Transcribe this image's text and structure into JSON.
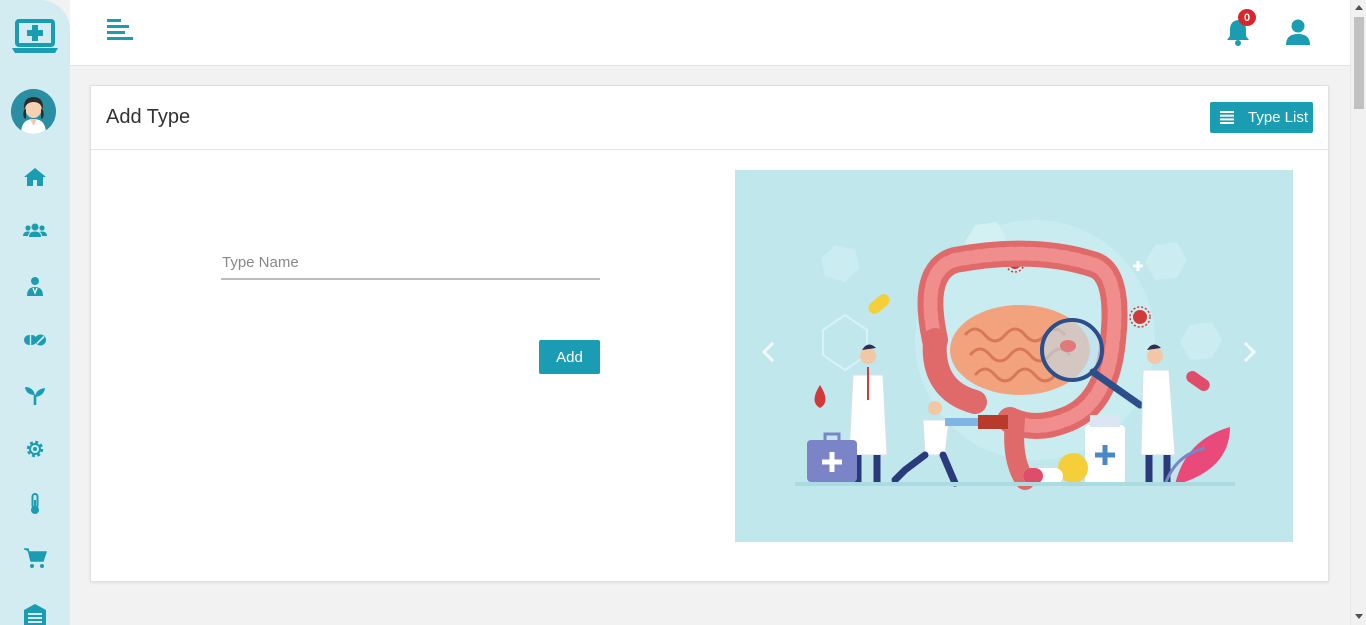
{
  "app": {
    "brand_icon": "medical-laptop-icon",
    "accent_color": "#1a9db3"
  },
  "sidebar": {
    "avatar": "doctor-avatar",
    "items": [
      {
        "icon": "home-icon"
      },
      {
        "icon": "users-icon"
      },
      {
        "icon": "doctor-icon"
      },
      {
        "icon": "pills-icon"
      },
      {
        "icon": "seedling-icon"
      },
      {
        "icon": "gear-icon"
      },
      {
        "icon": "thermometer-icon"
      },
      {
        "icon": "cart-icon"
      },
      {
        "icon": "warehouse-icon"
      }
    ]
  },
  "topbar": {
    "menu_icon": "menu-toggle-icon",
    "notification_count": "0",
    "user_icon": "user-icon"
  },
  "card": {
    "title": "Add Type",
    "type_list_label": "Type List",
    "form": {
      "type_name_placeholder": "Type Name",
      "type_name_value": ""
    },
    "add_label": "Add"
  },
  "carousel": {
    "image": "intestine-doctors-illustration"
  }
}
